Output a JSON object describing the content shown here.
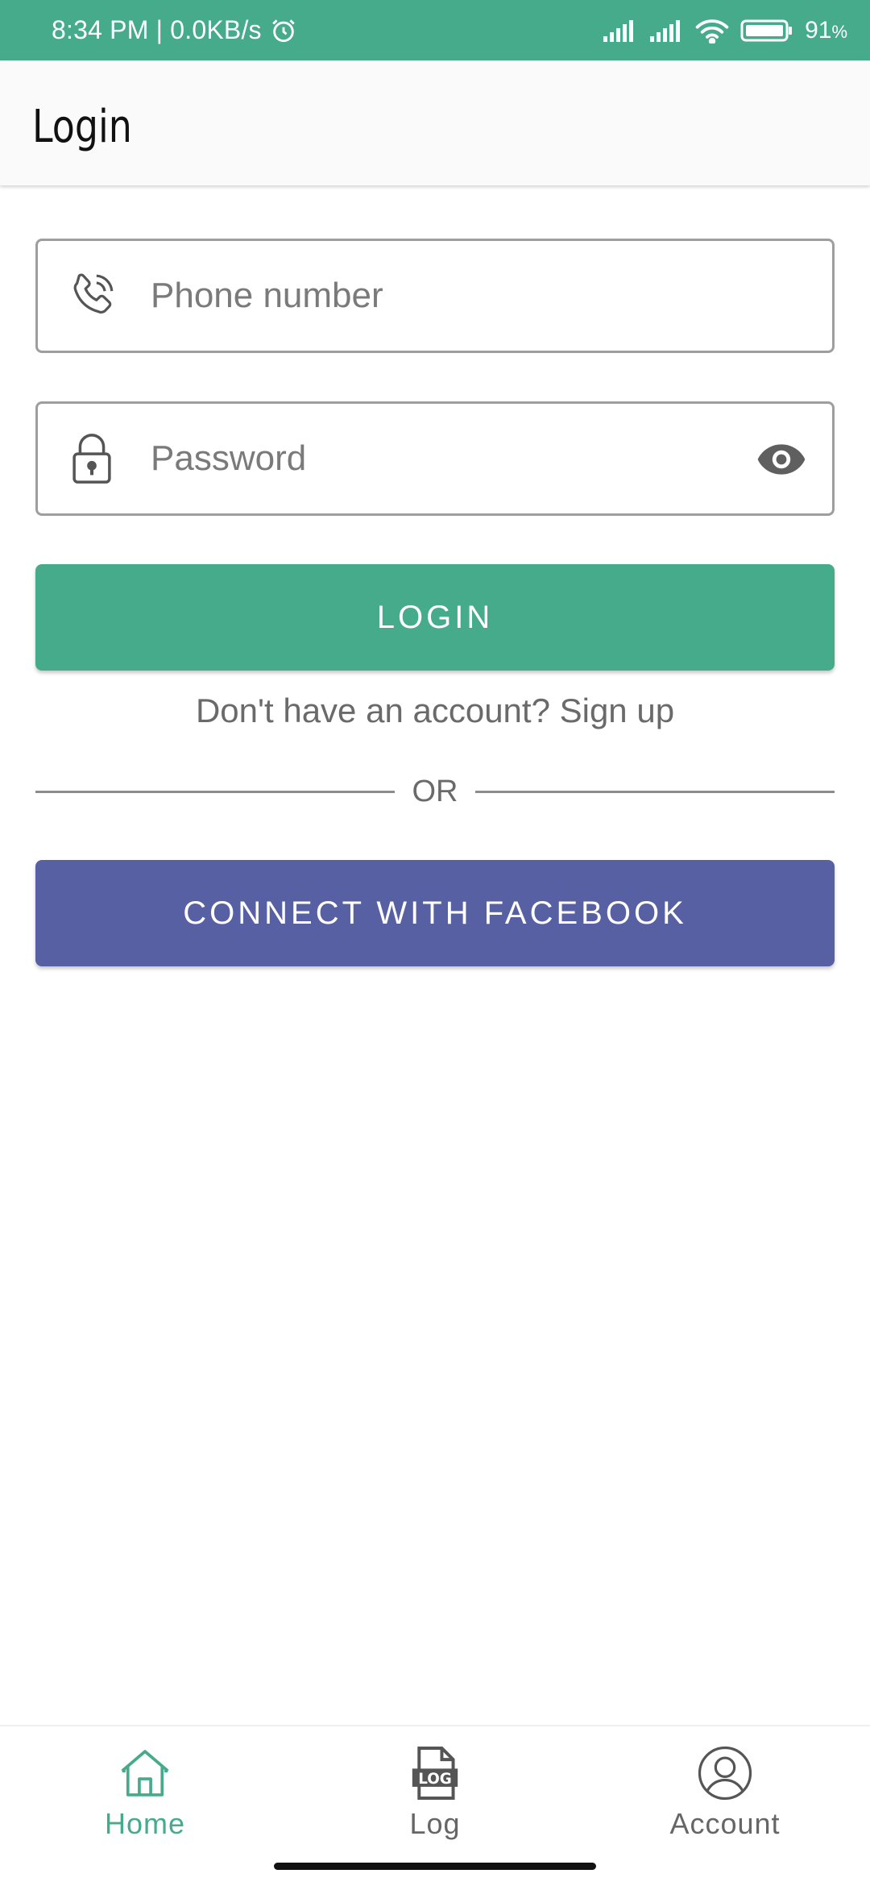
{
  "status_bar": {
    "time": "8:34 PM",
    "network_speed": "0.0KB/s",
    "battery": "91",
    "battery_unit": "%"
  },
  "app_bar": {
    "title": "Login"
  },
  "form": {
    "phone_placeholder": "Phone number",
    "password_placeholder": "Password",
    "login_label": "LOGIN",
    "signup_text": "Don't have an account? Sign up",
    "or_text": "OR",
    "facebook_label": "CONNECT WITH FACEBOOK"
  },
  "bottom_nav": {
    "items": [
      {
        "label": "Home",
        "icon": "home-icon",
        "active": true
      },
      {
        "label": "Log",
        "icon": "log-icon",
        "active": false
      },
      {
        "label": "Account",
        "icon": "account-icon",
        "active": false
      }
    ]
  },
  "colors": {
    "primary": "#46ab8b",
    "facebook": "#5760a3",
    "text_secondary": "#6a6a6a"
  }
}
